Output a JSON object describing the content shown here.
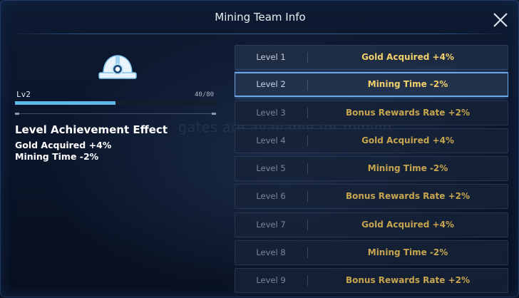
{
  "dialog": {
    "title": "Mining Team Info",
    "close_icon": "close-icon"
  },
  "background_text": "gates are available for mining",
  "team": {
    "icon": "miner-helmet-icon",
    "level_label": "Lv2",
    "progress_text": "40/80",
    "progress_fraction": 0.5
  },
  "effect": {
    "heading": "Level Achievement Effect",
    "lines": [
      "Gold Acquired +4%",
      "Mining Time -2%"
    ]
  },
  "levels": [
    {
      "label": "Level 1",
      "effect": "Gold Acquired +4%"
    },
    {
      "label": "Level 2",
      "effect": "Mining Time -2%"
    },
    {
      "label": "Level 3",
      "effect": "Bonus Rewards Rate +2%"
    },
    {
      "label": "Level 4",
      "effect": "Gold Acquired +4%"
    },
    {
      "label": "Level 5",
      "effect": "Mining Time -2%"
    },
    {
      "label": "Level 6",
      "effect": "Bonus Rewards Rate +2%"
    },
    {
      "label": "Level 7",
      "effect": "Gold Acquired +4%"
    },
    {
      "label": "Level 8",
      "effect": "Mining Time -2%"
    },
    {
      "label": "Level 9",
      "effect": "Bonus Rewards Rate +2%"
    }
  ],
  "colors": {
    "accent_blue": "#5fb8e6",
    "selected_border": "#6aa6e8",
    "effect_gold": "#f2d06b",
    "effect_gold_dim": "#c7a54f"
  }
}
